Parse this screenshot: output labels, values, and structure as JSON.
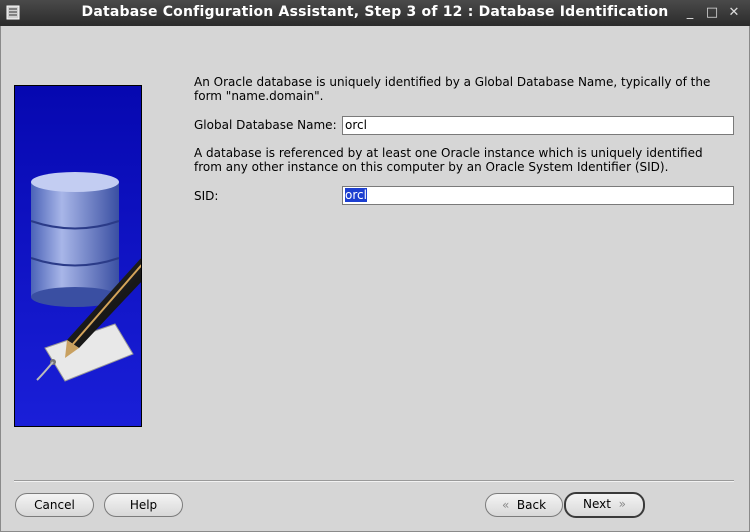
{
  "window": {
    "title": "Database Configuration Assistant, Step 3 of 12 : Database Identification",
    "controls": {
      "minimize": "_",
      "maximize": "□",
      "close": "✕"
    }
  },
  "main": {
    "intro_text": "An Oracle database is uniquely identified by a Global Database Name, typically of the form \"name.domain\".",
    "global_db_name_label": "Global Database Name:",
    "global_db_name_value": "orcl",
    "sid_intro_text": "A database is referenced by at least one Oracle instance which is uniquely identified from any other instance on this computer by an Oracle System Identifier (SID).",
    "sid_label": "SID:",
    "sid_value": "orcl"
  },
  "footer": {
    "cancel_label": "Cancel",
    "help_label": "Help",
    "back_label": "Back",
    "next_label": "Next"
  },
  "colors": {
    "titlebar": "#2b2b2b",
    "background": "#d6d6d6",
    "side_panel": "#0a0fc0",
    "selection": "#1d3fd0"
  }
}
